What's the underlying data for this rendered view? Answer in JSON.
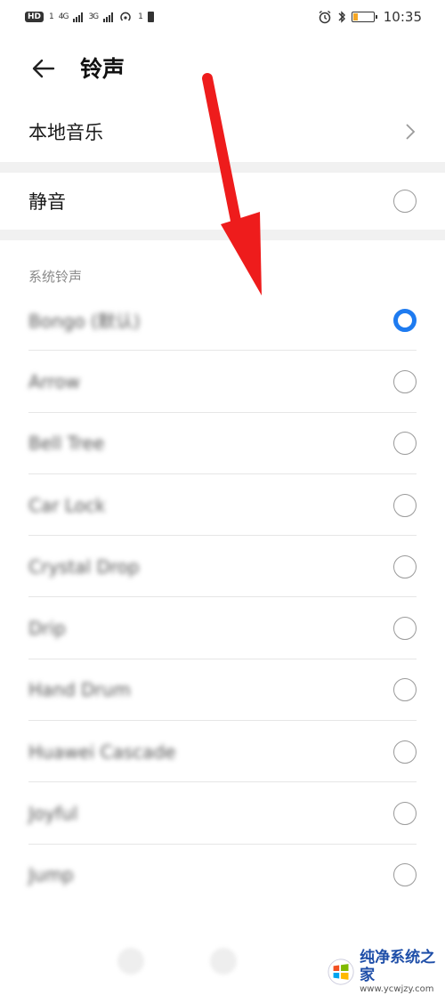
{
  "status_bar": {
    "hd_label": "HD",
    "sim1": "1",
    "network1": "4G",
    "network2": "3G",
    "hotspot_sup": "1",
    "time": "10:35",
    "battery_color": "#f5a623",
    "battery_level": 0.2
  },
  "header": {
    "title": "铃声"
  },
  "settings": {
    "local_music": "本地音乐",
    "silent": "静音"
  },
  "system_ringtones": {
    "header": "系统铃声",
    "items": [
      {
        "name": "Bongo (默认)",
        "selected": true
      },
      {
        "name": "Arrow",
        "selected": false
      },
      {
        "name": "Bell Tree",
        "selected": false
      },
      {
        "name": "Car Lock",
        "selected": false
      },
      {
        "name": "Crystal Drop",
        "selected": false
      },
      {
        "name": "Drip",
        "selected": false
      },
      {
        "name": "Hand Drum",
        "selected": false
      },
      {
        "name": "Huawei Cascade",
        "selected": false
      },
      {
        "name": "Joyful",
        "selected": false
      },
      {
        "name": "Jump",
        "selected": false
      }
    ]
  },
  "watermark": {
    "main": "纯净系统之家",
    "url": "www.ycwjzy.com"
  },
  "colors": {
    "accent": "#1e7bf0",
    "arrow": "#ee1c1c"
  }
}
